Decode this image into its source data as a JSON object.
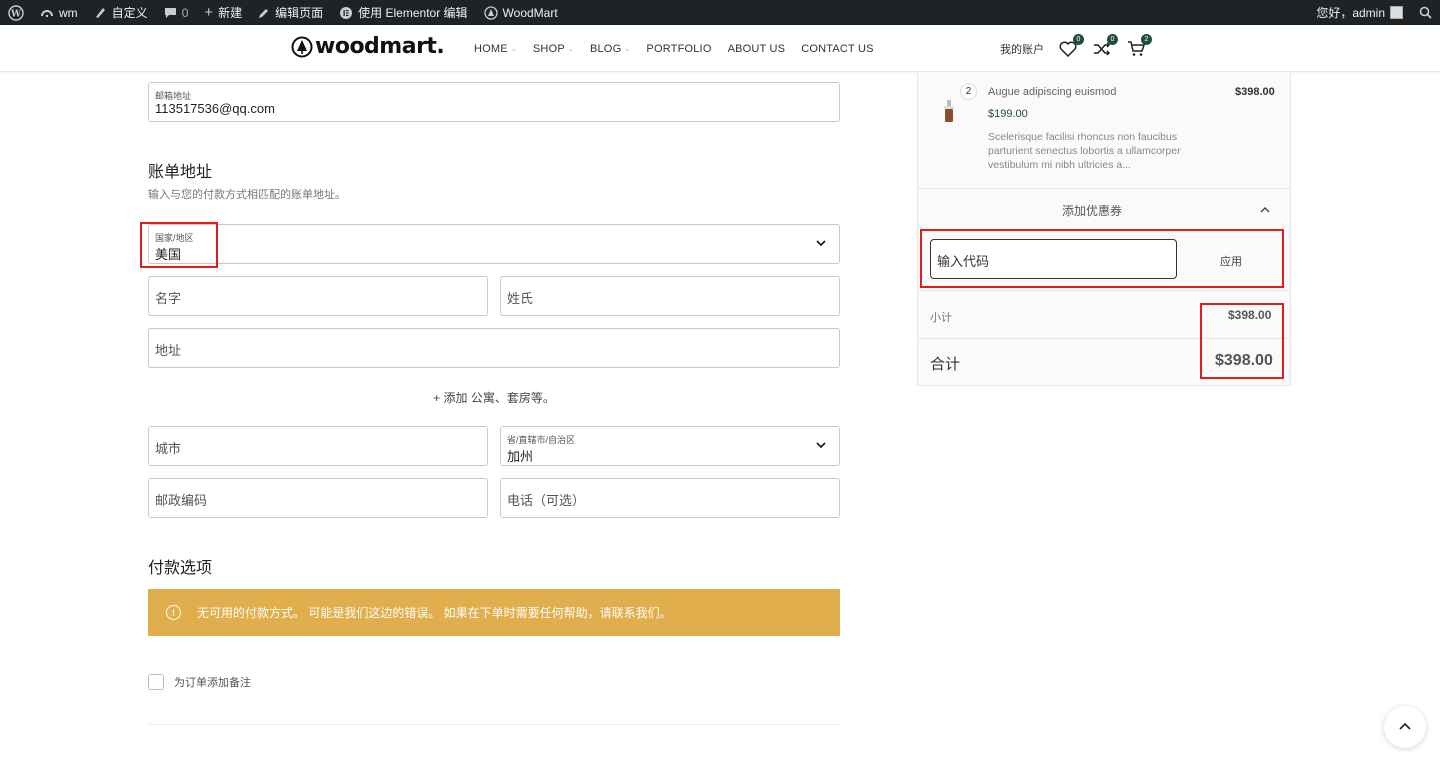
{
  "adminbar": {
    "site": "wm",
    "customize": "自定义",
    "comments": "0",
    "new": "新建",
    "edit_page": "编辑页面",
    "elementor": "使用 Elementor 编辑",
    "woodmart": "WoodMart",
    "greeting": "您好，admin"
  },
  "header": {
    "logo": "woodmart.",
    "nav": [
      "HOME",
      "SHOP",
      "BLOG",
      "PORTFOLIO",
      "ABOUT US",
      "CONTACT US"
    ],
    "account": "我的账户",
    "wishlist_count": "0",
    "compare_count": "0",
    "cart_count": "2"
  },
  "form": {
    "email": {
      "label": "邮箱地址",
      "value": "113517536@qq.com"
    },
    "billing_title": "账单地址",
    "billing_sub": "输入与您的付款方式相匹配的账单地址。",
    "country": {
      "label": "国家/地区",
      "value": "美国"
    },
    "first_name_ph": "名字",
    "last_name_ph": "姓氏",
    "address_ph": "地址",
    "add_more": "+ 添加 公寓、套房等。",
    "city_ph": "城市",
    "state": {
      "label": "省/直辖市/自治区",
      "value": "加州"
    },
    "postcode_ph": "邮政编码",
    "phone_ph": "电话（可选）",
    "payment_title": "付款选项",
    "payment_notice": "无可用的付款方式。 可能是我们这边的错误。 如果在下单时需要任何帮助，请联系我们。",
    "order_note": "为订单添加备注"
  },
  "summary": {
    "item": {
      "qty": "2",
      "name": "Augue adipiscing euismod",
      "unit_price": "$199.00",
      "line_total": "$398.00",
      "description": [
        "Scelerisque facilisi rhoncus non faucibus",
        "parturient senectus lobortis a ullamcorper",
        "vestibulum mi nibh ultricies a..."
      ]
    },
    "coupon_toggle": "添加优惠券",
    "coupon_ph": "输入代码",
    "apply": "应用",
    "subtotal_label": "小计",
    "subtotal": "$398.00",
    "total_label": "合计",
    "total": "$398.00"
  },
  "colors": {
    "accent": "#1f4d3e",
    "notice": "#e1ae4d",
    "highlight": "#e01c1c",
    "adminbar": "#1d2327"
  }
}
